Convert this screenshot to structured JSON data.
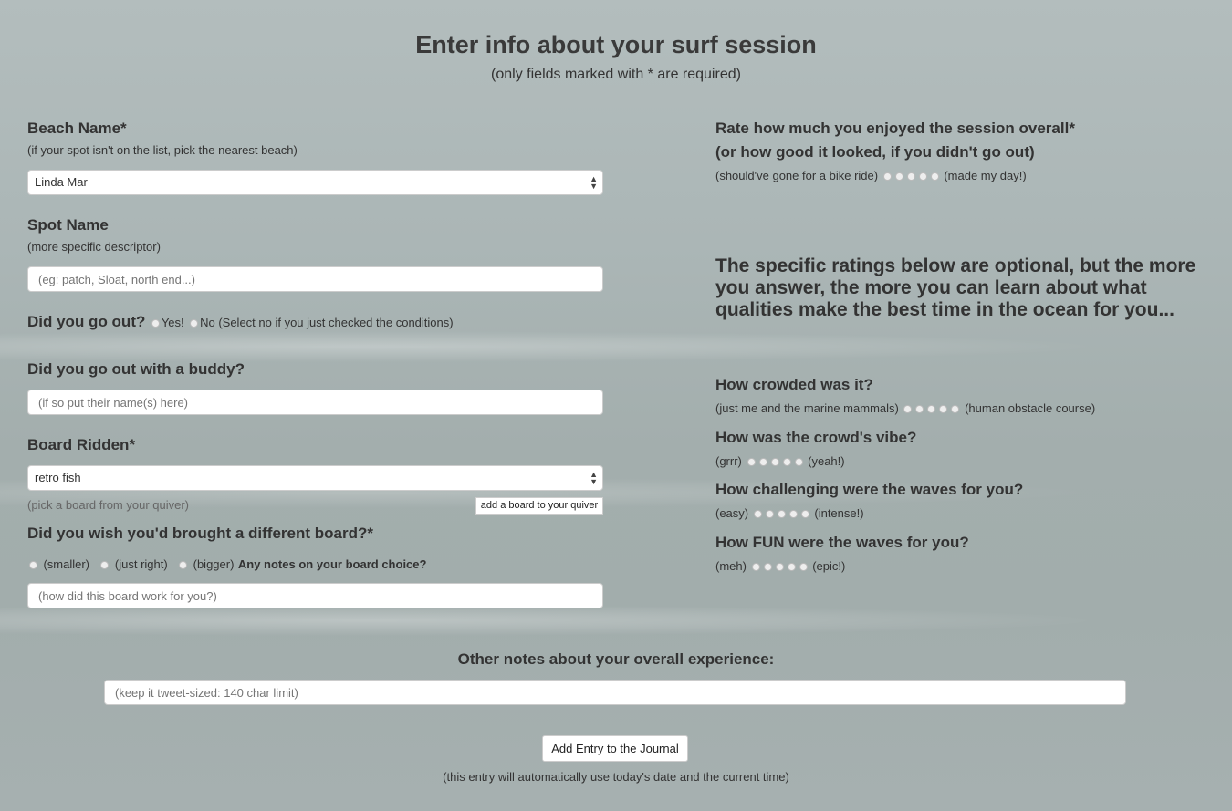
{
  "header": {
    "title": "Enter info about your surf session",
    "subtitle": "(only fields marked with * are required)"
  },
  "beach": {
    "label": "Beach Name*",
    "hint": "(if your spot isn't on the list, pick the nearest beach)",
    "value": "Linda Mar"
  },
  "spot": {
    "label": "Spot Name",
    "hint": "(more specific descriptor)",
    "placeholder": "(eg: patch, Sloat, north end...)"
  },
  "went_out": {
    "label": "Did you go out?",
    "yes": "Yes!",
    "no": "No (Select no if you just checked the conditions)"
  },
  "buddy": {
    "label": "Did you go out with a buddy?",
    "placeholder": "(if so put their name(s) here)"
  },
  "board": {
    "label": "Board Ridden*",
    "value": "retro fish",
    "hint": "(pick a board from your quiver)",
    "add_button": "add a board to your quiver"
  },
  "board_wish": {
    "label": "Did you wish you'd brought a different board?*",
    "options": [
      "(smaller)",
      "(just right)",
      "(bigger)"
    ],
    "notes_label": "Any notes on your board choice?",
    "notes_placeholder": "(how did this board work for you?)"
  },
  "overall": {
    "label": "Rate how much you enjoyed the session overall*",
    "sublabel": "(or how good it looked, if you didn't go out)",
    "low": "(should've gone for a bike ride)",
    "high": "(made my day!)"
  },
  "optional_note": "The specific ratings below are optional, but the more you answer, the more you can learn about what qualities make the best time in the ocean for you...",
  "ratings": [
    {
      "label": "How crowded was it?",
      "low": "(just me and the marine mammals)",
      "high": "(human obstacle course)"
    },
    {
      "label": "How was the crowd's vibe?",
      "low": "(grrr)",
      "high": "(yeah!)"
    },
    {
      "label": "How challenging were the waves for you?",
      "low": "(easy)",
      "high": "(intense!)"
    },
    {
      "label": "How FUN were the waves for you?",
      "low": "(meh)",
      "high": "(epic!)"
    }
  ],
  "notes": {
    "label": "Other notes about your overall experience:",
    "placeholder": "(keep it tweet-sized: 140 char limit)"
  },
  "submit": {
    "label": "Add Entry to the Journal",
    "hint": "(this entry will automatically use today's date and the current time)"
  }
}
